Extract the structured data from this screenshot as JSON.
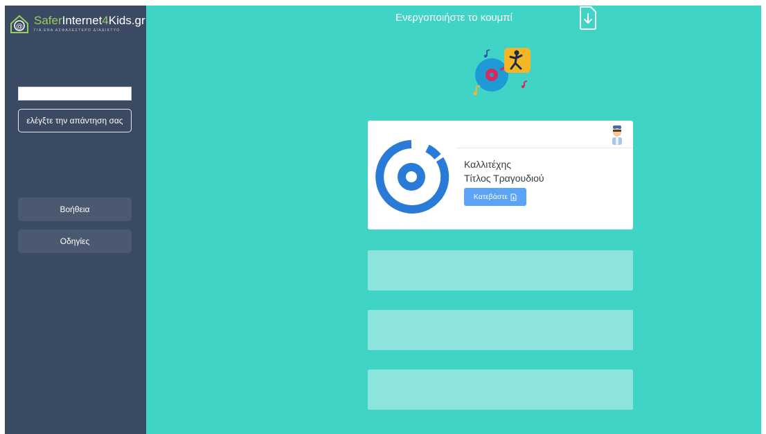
{
  "brand": {
    "part1": "Safer",
    "part2": "Internet",
    "part3": "4",
    "part4": "Kids.gr",
    "tagline": "ΓΙΑ ΕΝΑ ΑΣΦΑΛΕΣΤΕΡΟ ΔΙΑΔΙΚΤΥΟ"
  },
  "sidebar": {
    "answer_value": "",
    "check_label": "ελέγξτε την απάντηση σας",
    "help_label": "Βοήθεια",
    "guide_label": "Οδηγίες"
  },
  "main": {
    "instruction": "Ενεργοποιήστε το κουμπί",
    "card": {
      "artist": "Καλλιτέχης",
      "title": "Τίτλος Τραγουδιού",
      "download_label": "Κατεβάστε"
    }
  },
  "colors": {
    "sidebar": "#3b4a63",
    "main_bg": "#40d4c6",
    "accent": "#5ba3f5",
    "placeholder": "#8de4dc"
  },
  "icons": {
    "logo": "safer-internet-logo-icon",
    "download_doc": "download-document-icon",
    "music": "music-dance-illustration",
    "avatar": "kid-avatar-icon",
    "album": "music-disc-icon"
  }
}
